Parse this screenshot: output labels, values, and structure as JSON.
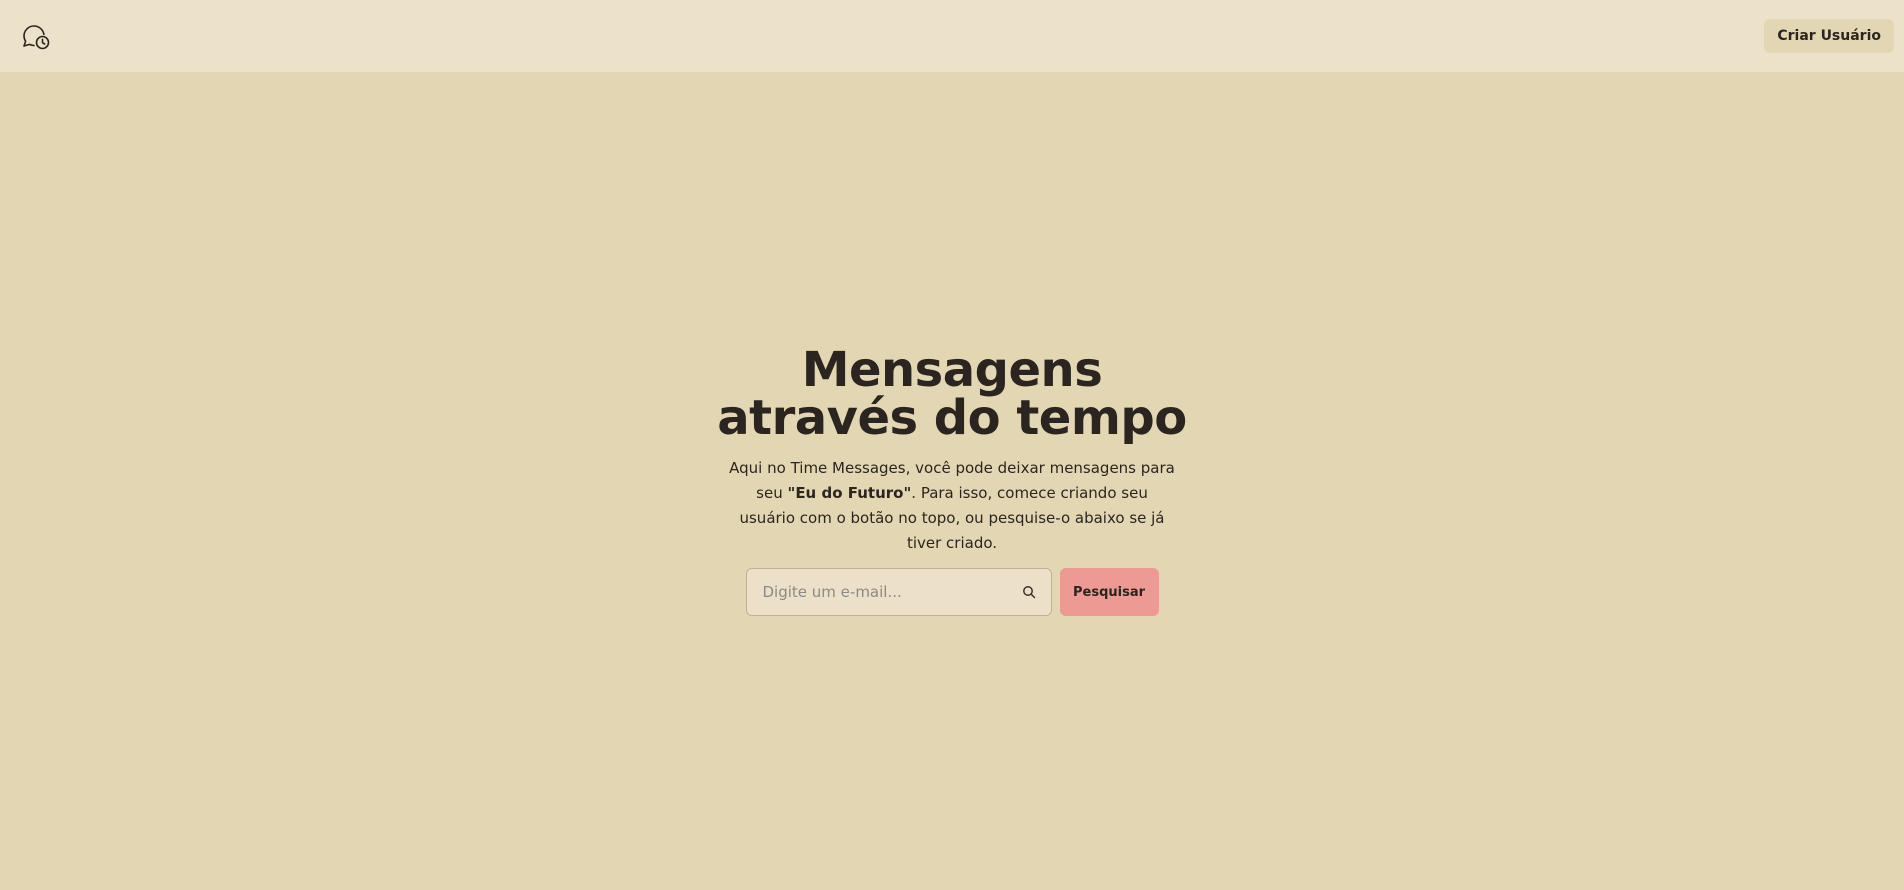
{
  "header": {
    "logo_icon": "chat-clock-icon",
    "create_user_label": "Criar Usuário"
  },
  "hero": {
    "title": "Mensagens através do tempo",
    "description_prefix": "Aqui no Time Messages, você pode deixar mensagens para seu ",
    "description_highlight": "\"Eu do Futuro\"",
    "description_suffix": ". Para isso, comece criando seu usuário com o botão no topo, ou pesquise-o abaixo se já tiver criado."
  },
  "search": {
    "placeholder": "Digite um e-mail...",
    "value": "",
    "icon": "search-icon",
    "button_label": "Pesquisar"
  },
  "colors": {
    "background": "#e3d7b3",
    "header_background": "#ece2ca",
    "accent_button": "#ec9a93",
    "text": "#2b2521"
  }
}
